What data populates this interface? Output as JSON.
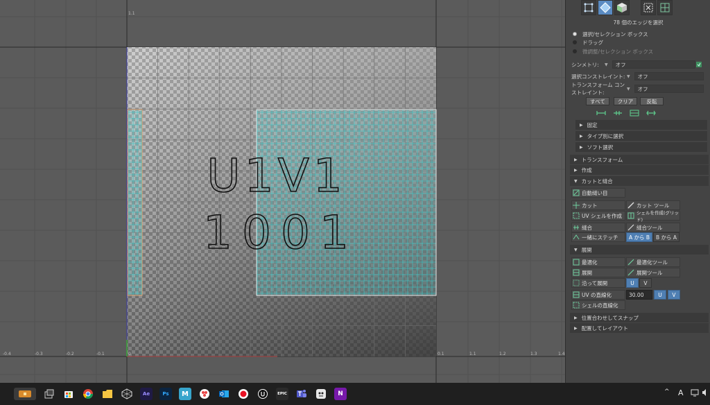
{
  "viewport": {
    "uv_text_line1": "U1V1",
    "uv_text_line2": "1001",
    "axis_ticks": [
      "-0.4",
      "-0.3",
      "-0.2",
      "-0.1",
      "0",
      "0.1",
      "1.1",
      "1.2",
      "1.3",
      "1.4"
    ],
    "top_tick": "1.1"
  },
  "panel": {
    "selection_count": "78 個のエッジを選択",
    "radio_options": [
      {
        "label": "選択/セレクション ボックス",
        "selected": true
      },
      {
        "label": "ドラッグ",
        "selected": false
      },
      {
        "label": "微調整/セレクション ボックス",
        "selected": false
      }
    ],
    "symmetry": {
      "label": "シンメトリ:",
      "value": "オフ"
    },
    "select_constraint": {
      "label": "選択コンストレイント:",
      "value": "オフ"
    },
    "transform_constraint": {
      "label": "トランスフォーム コンストレイント:",
      "value": "オフ"
    },
    "buttons": {
      "all": "すべて",
      "clear": "クリア",
      "invert": "反転"
    },
    "subsections": [
      "固定",
      "タイプ別に選択",
      "ソフト選択"
    ],
    "sections": {
      "transform": "トランスフォーム",
      "create": "作成",
      "cut_sew": "カットと縫合",
      "unfold": "展開",
      "align_snap": "位置合わせしてスナップ",
      "arrange_layout": "配置してレイアウト"
    },
    "cut_sew_tools": {
      "auto_seams": "自動縫い目",
      "cut": "カット",
      "cut_tool": "カット ツール",
      "create_uv_shell": "UV シェルを作成",
      "create_shell_grid": "シェルを作成(グリッド)",
      "sew": "縫合",
      "sew_tool": "縫合ツール",
      "stitch_together": "一緒にステッチ",
      "a_to_b": "A から B",
      "b_to_a": "B から A"
    },
    "unfold_tools": {
      "optimize": "最適化",
      "optimize_tool": "最適化ツール",
      "unfold": "展開",
      "unfold_tool": "展開ツール",
      "unfold_along": "沿って展開",
      "u": "U",
      "v": "V",
      "straighten_uv": "UV の直線化",
      "straighten_value": "30.00",
      "straighten_shell": "シェルの直線化"
    }
  },
  "taskbar": {
    "apps": [
      "Ae",
      "Ps",
      "M",
      "EPIC",
      "N"
    ],
    "ime_indicator": "A"
  }
}
